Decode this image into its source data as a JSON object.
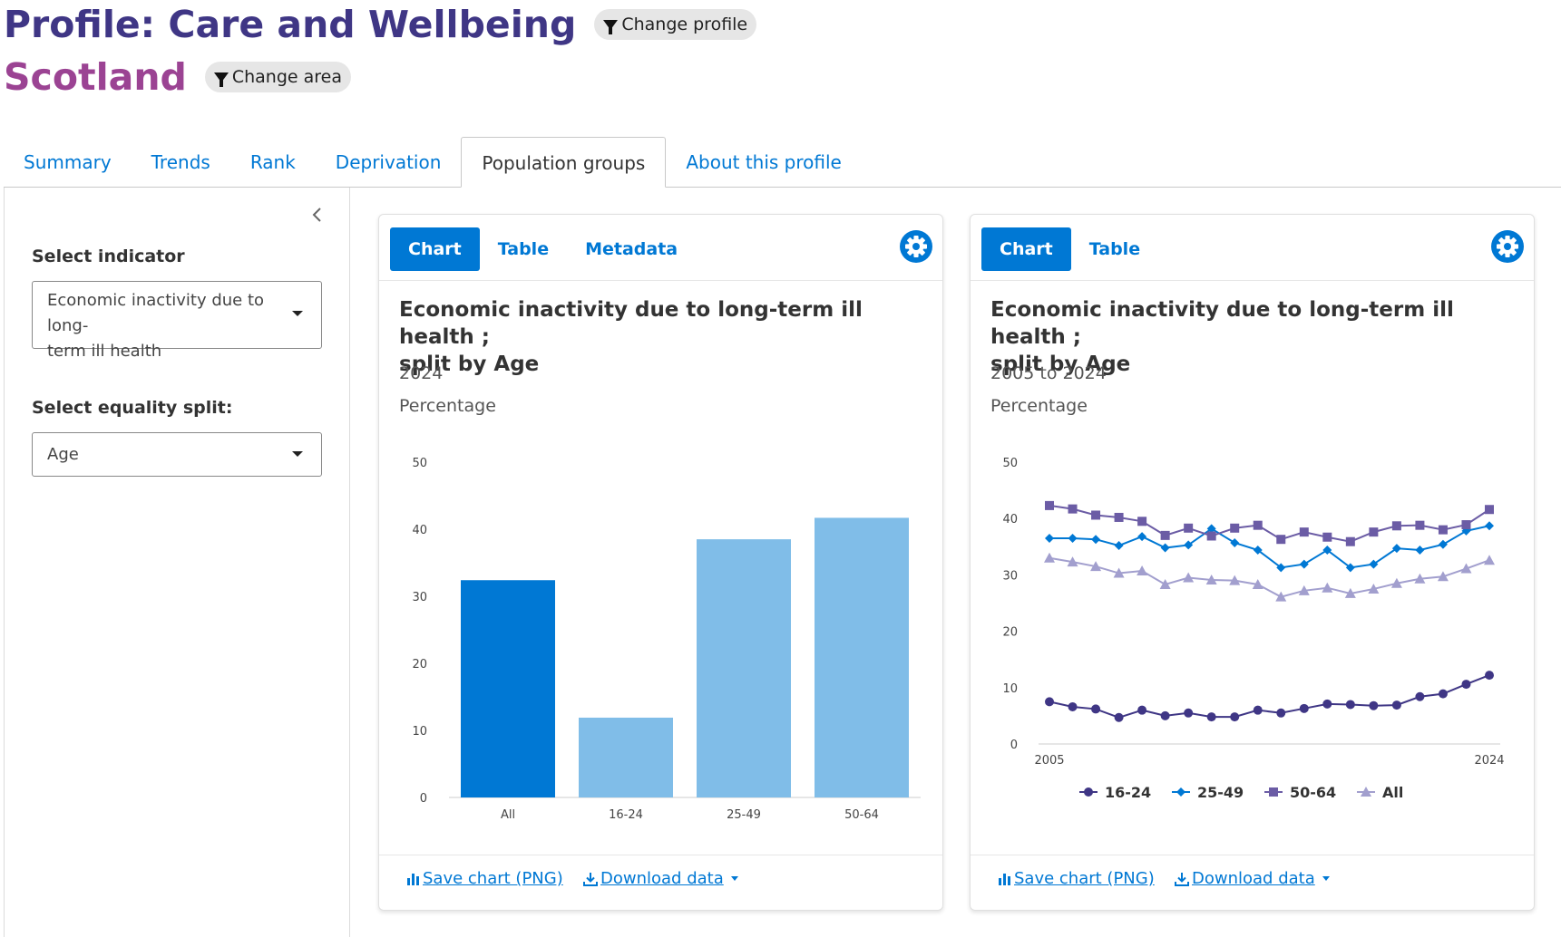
{
  "header": {
    "profile_title": "Profile: Care and Wellbeing",
    "change_profile": "Change profile",
    "area_title": "Scotland",
    "change_area": "Change area"
  },
  "tabs": [
    {
      "label": "Summary"
    },
    {
      "label": "Trends"
    },
    {
      "label": "Rank"
    },
    {
      "label": "Deprivation"
    },
    {
      "label": "Population groups",
      "active": true
    },
    {
      "label": "About this profile"
    }
  ],
  "sidebar": {
    "indicator_label": "Select indicator",
    "indicator_line1": "Economic inactivity due to long-",
    "indicator_line2": "term ill health",
    "split_label": "Select equality split:",
    "split_value": "Age"
  },
  "bar_card": {
    "tabs": [
      "Chart",
      "Table",
      "Metadata"
    ],
    "title_line1": "Economic inactivity due to long-term ill health ;",
    "title_line2": "split by Age",
    "period": "2024",
    "measure": "Percentage",
    "save_label": "Save chart (PNG)",
    "download_label": "Download data"
  },
  "line_card": {
    "tabs": [
      "Chart",
      "Table"
    ],
    "title_line1": "Economic inactivity due to long-term ill health ;",
    "title_line2": "split by Age",
    "period": "2005 to 2024",
    "measure": "Percentage",
    "save_label": "Save chart (PNG)",
    "download_label": "Download data"
  },
  "colors": {
    "accent": "#0078d4",
    "bar_highlight": "#0078d4",
    "bar_light": "#80bde8",
    "s16_24": "#3f3685",
    "s25_49": "#0078d4",
    "s50_64": "#6b5ca5",
    "sAll": "#a29fce"
  },
  "chart_data": [
    {
      "type": "bar",
      "categories": [
        "All",
        "16-24",
        "25-49",
        "50-64"
      ],
      "values": [
        32.4,
        11.9,
        38.5,
        41.7
      ],
      "ylim": [
        0,
        50
      ],
      "yticks": [
        0,
        10,
        20,
        30,
        40,
        50
      ],
      "grid": false
    },
    {
      "type": "line",
      "x": [
        2005,
        2006,
        2007,
        2008,
        2009,
        2010,
        2011,
        2012,
        2013,
        2014,
        2015,
        2016,
        2017,
        2018,
        2019,
        2020,
        2021,
        2022,
        2023,
        2024
      ],
      "x_tick_labels": [
        "2005",
        "2024"
      ],
      "ylim": [
        0,
        50
      ],
      "yticks": [
        0,
        10,
        20,
        30,
        40,
        50
      ],
      "legend_position": "bottom",
      "series": [
        {
          "name": "16-24",
          "marker": "circle",
          "values": [
            7.5,
            6.6,
            6.2,
            4.7,
            6.0,
            5.0,
            5.5,
            4.8,
            4.8,
            6.0,
            5.5,
            6.3,
            7.1,
            7.0,
            6.8,
            6.9,
            8.4,
            8.9,
            10.6,
            12.2
          ]
        },
        {
          "name": "25-49",
          "marker": "diamond",
          "values": [
            36.5,
            36.5,
            36.3,
            35.2,
            36.8,
            34.8,
            35.3,
            38.2,
            35.7,
            34.4,
            31.3,
            31.9,
            34.4,
            31.3,
            31.9,
            34.7,
            34.4,
            35.4,
            37.8,
            38.7
          ]
        },
        {
          "name": "50-64",
          "marker": "square",
          "values": [
            42.3,
            41.7,
            40.6,
            40.2,
            39.5,
            37.0,
            38.3,
            36.9,
            38.3,
            38.8,
            36.3,
            37.6,
            36.7,
            35.9,
            37.6,
            38.7,
            38.8,
            38.0,
            38.9,
            41.6
          ]
        },
        {
          "name": "All",
          "marker": "triangle",
          "values": [
            33.0,
            32.3,
            31.5,
            30.3,
            30.7,
            28.3,
            29.5,
            29.1,
            29.0,
            28.3,
            26.1,
            27.2,
            27.7,
            26.7,
            27.5,
            28.5,
            29.3,
            29.7,
            31.1,
            32.6
          ]
        }
      ]
    }
  ]
}
